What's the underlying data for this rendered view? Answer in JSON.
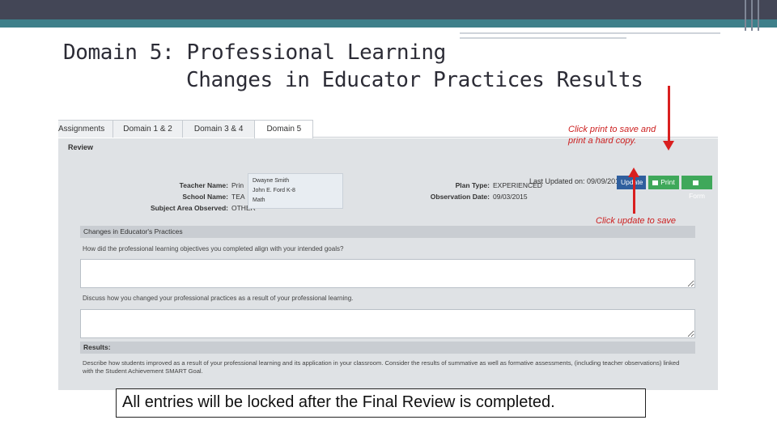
{
  "slide": {
    "title_line1": "Domain 5: Professional Learning",
    "title_line2": "Changes in Educator Practices Results",
    "caption": "All entries will be locked after the Final Review is completed."
  },
  "annotations": {
    "print_note_line1": "Click print to save and",
    "print_note_line2": "print a hard copy.",
    "update_note": "Click update to save",
    "arrow_color": "#d91f1f"
  },
  "app": {
    "tabs": [
      {
        "label": "Assignments",
        "active": false
      },
      {
        "label": "Domain 1 & 2",
        "active": false
      },
      {
        "label": "Domain 3 & 4",
        "active": false
      },
      {
        "label": "Domain 5",
        "active": true
      }
    ],
    "review_label": "Review",
    "last_updated": "Last Updated on: 09/09/2015",
    "buttons": {
      "update": "Update",
      "print": "Print",
      "form": "Form"
    },
    "info": {
      "teacher_name_label": "Teacher Name:",
      "teacher_name_value": "Prin",
      "school_name_label": "School Name:",
      "school_name_value": "TEA",
      "subject_label": "Subject Area Observed:",
      "subject_value": "OTHER",
      "plan_type_label": "Plan Type:",
      "plan_type_value": "EXPERIENCED",
      "observation_date_label": "Observation Date:",
      "observation_date_value": "09/03/2015"
    },
    "dropdown_items": [
      "Dwayne Smith",
      "John E. Ford K-8",
      "Math"
    ],
    "sections": {
      "changes_header": "Changes in Educator's Practices",
      "question1": "How did the professional learning objectives you completed align with your intended goals?",
      "question2": "Discuss how you changed your professional practices as a result of your professional learning.",
      "results_header": "Results:",
      "results_text_line1": "Describe how students improved as a result of your professional learning and its application in your classroom. Consider the results of summative as well as formative assessments, (including teacher observations) linked",
      "results_text_line2": "with the Student Achievement SMART Goal."
    }
  },
  "colors": {
    "topbar": "#434656",
    "teal": "#3e7f8a",
    "update_button": "#2f5f9e",
    "green_button": "#3fa85a"
  }
}
